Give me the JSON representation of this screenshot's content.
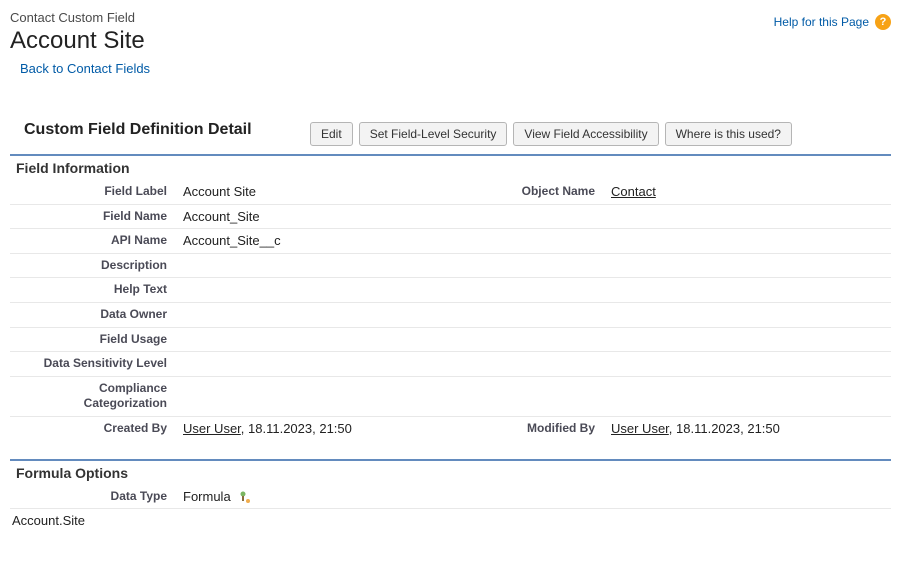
{
  "header": {
    "pretitle": "Contact Custom Field",
    "title": "Account Site",
    "back_link": "Back to Contact Fields",
    "help_text": "Help for this Page",
    "help_glyph": "?"
  },
  "detail": {
    "section_title": "Custom Field Definition Detail",
    "buttons": {
      "edit": "Edit",
      "set_fls": "Set Field-Level Security",
      "view_fa": "View Field Accessibility",
      "where_used": "Where is this used?"
    }
  },
  "sections": {
    "field_info": "Field Information",
    "formula_options": "Formula Options"
  },
  "fields": {
    "field_label": {
      "label": "Field Label",
      "value": "Account Site"
    },
    "object_name": {
      "label": "Object Name",
      "value": "Contact"
    },
    "field_name": {
      "label": "Field Name",
      "value": "Account_Site"
    },
    "api_name": {
      "label": "API Name",
      "value": "Account_Site__c"
    },
    "description": {
      "label": "Description",
      "value": ""
    },
    "help_text": {
      "label": "Help Text",
      "value": ""
    },
    "data_owner": {
      "label": "Data Owner",
      "value": ""
    },
    "field_usage": {
      "label": "Field Usage",
      "value": ""
    },
    "data_sensitivity": {
      "label": "Data Sensitivity Level",
      "value": ""
    },
    "compliance": {
      "label": "Compliance Categorization",
      "value": ""
    },
    "created_by": {
      "label": "Created By",
      "user": "User User",
      "date": ", 18.11.2023, 21:50"
    },
    "modified_by": {
      "label": "Modified By",
      "user": "User User",
      "date": ", 18.11.2023, 21:50"
    },
    "data_type": {
      "label": "Data Type",
      "value": "Formula"
    },
    "formula_body": "Account.Site"
  }
}
